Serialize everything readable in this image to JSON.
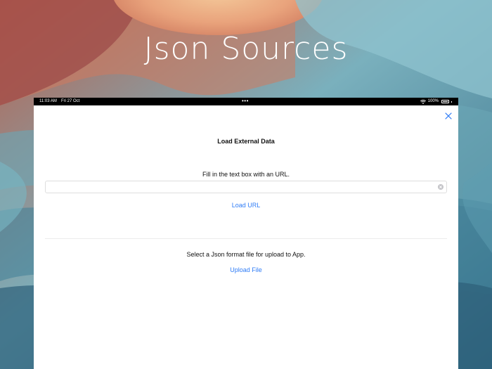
{
  "hero": {
    "title": "Json Sources"
  },
  "status_bar": {
    "time": "11:03 AM",
    "date": "Fri 27 Oct",
    "dots": "•••",
    "battery_percent": "100%"
  },
  "modal": {
    "title": "Load External Data",
    "url_section": {
      "prompt": "Fill in the text box with an URL.",
      "input_value": "",
      "input_placeholder": "",
      "load_button_label": "Load URL"
    },
    "file_section": {
      "prompt": "Select a Json format file for upload to App.",
      "upload_button_label": "Upload File"
    },
    "close_icon": "close-icon"
  },
  "colors": {
    "accent": "#2f7cf6",
    "background_teal": "#4f8ea3",
    "background_warm": "#c96a52"
  }
}
